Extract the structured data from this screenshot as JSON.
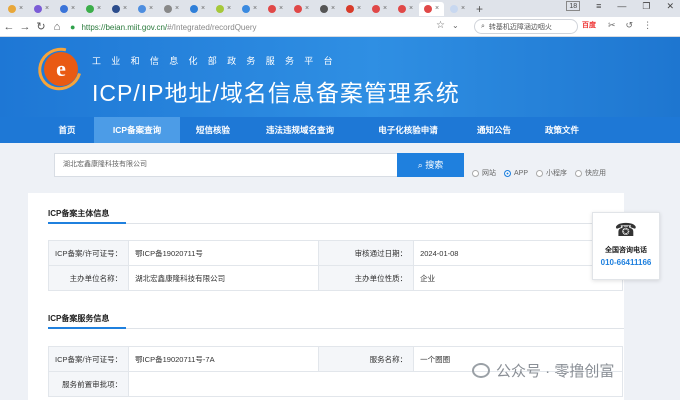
{
  "browser": {
    "url_host": "https://beian.miit.gov.cn/",
    "url_path": "#/Integrated/recordQuery",
    "search_text": "转基机迈障涵边咽火",
    "search_badge": "百度",
    "tab_close": "×",
    "new_tab": "+",
    "window_count": "18",
    "colors": {
      "tabbar": "#dfe3ea",
      "url": "#2a7a3c"
    }
  },
  "header": {
    "subtitle": "工业和信息化部政务服务平台",
    "title": "ICP/IP地址/域名信息备案管理系统",
    "logo_letter": "e"
  },
  "nav": {
    "items": [
      "首页",
      "ICP备案查询",
      "短信核验",
      "违法违规域名查询",
      "电子化核验申请",
      "通知公告",
      "政策文件"
    ],
    "active_index": 1
  },
  "query": {
    "input_value": "湖北宏鑫康隆科技有限公司",
    "button_label": "搜索",
    "options": [
      "网站",
      "APP",
      "小程序",
      "快应用"
    ],
    "selected_index": 1
  },
  "subject": {
    "heading": "ICP备案主体信息",
    "row1": {
      "k1": "ICP备案/许可证号：",
      "v1": "鄂ICP备19020711号",
      "k2": "审核通过日期：",
      "v2": "2024-01-08"
    },
    "row2": {
      "k1": "主办单位名称：",
      "v1": "湖北宏鑫康隆科技有限公司",
      "k2": "主办单位性质：",
      "v2": "企业"
    }
  },
  "service": {
    "heading": "ICP备案服务信息",
    "row1": {
      "k1": "ICP备案/许可证号：",
      "v1": "鄂ICP备19020711号-7A",
      "k2": "服务名称：",
      "v2": "一个圈圈"
    },
    "row2": {
      "k1": "服务前置审批项：",
      "v1": ""
    }
  },
  "phone_widget": {
    "label": "全国咨询电话",
    "number": "010-66411166"
  },
  "watermark": "公众号 · 零撸创富"
}
